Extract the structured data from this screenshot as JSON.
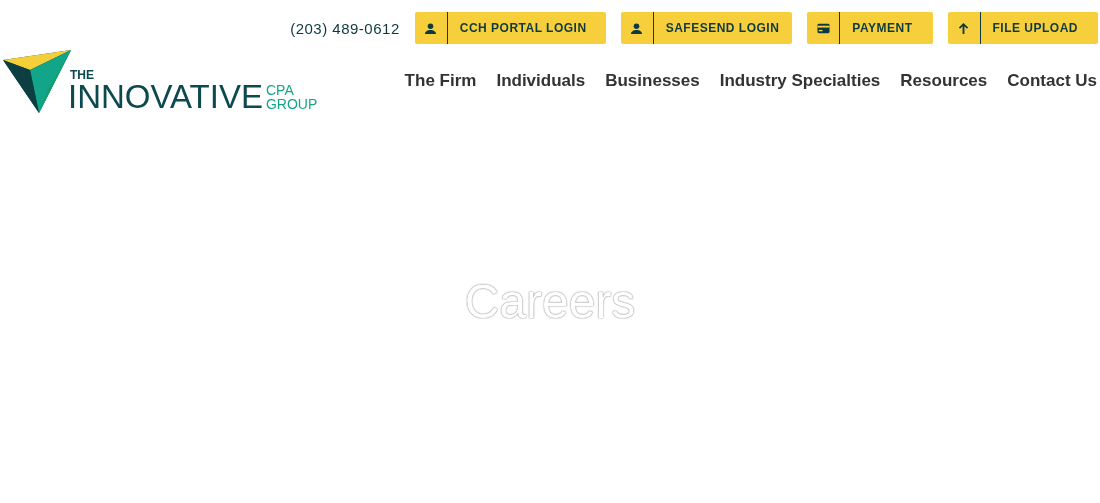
{
  "top_bar": {
    "phone": "(203) 489-0612",
    "buttons": [
      {
        "label": "CCH PORTAL LOGIN",
        "kind": "user"
      },
      {
        "label": "SAFESEND LOGIN",
        "kind": "user"
      },
      {
        "label": "PAYMENT",
        "kind": "card"
      },
      {
        "label": "FILE UPLOAD",
        "kind": "upload"
      }
    ]
  },
  "logo": {
    "small": "THE",
    "main": "INNOVATIVE",
    "side": [
      "CPA",
      "GROUP"
    ]
  },
  "nav": [
    "The Firm",
    "Individuals",
    "Businesses",
    "Industry Specialties",
    "Resources",
    "Contact Us"
  ],
  "hero": {
    "title": "Careers"
  }
}
